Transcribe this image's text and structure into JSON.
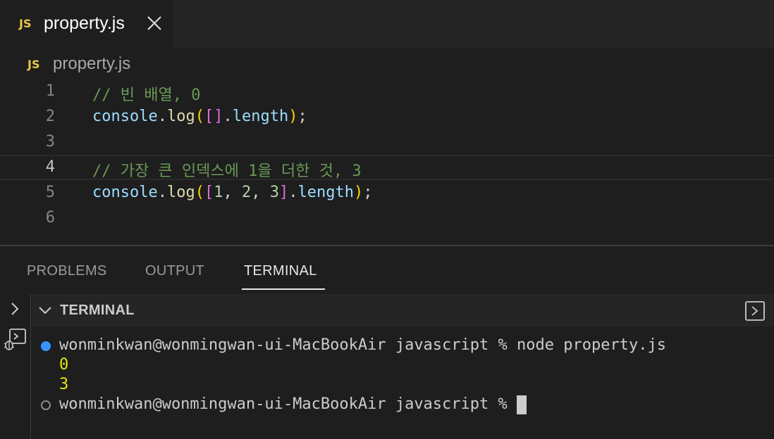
{
  "tab": {
    "lang_badge": "JS",
    "filename": "property.js"
  },
  "breadcrumb": {
    "lang_badge": "JS",
    "filename": "property.js"
  },
  "editor": {
    "lines": [
      {
        "number": "1"
      },
      {
        "number": "2"
      },
      {
        "number": "3"
      },
      {
        "number": "4"
      },
      {
        "number": "5"
      },
      {
        "number": "6"
      }
    ],
    "current_line": 4,
    "tokens": {
      "l1_comment": "// 빈 배열, 0",
      "l2_console": "console",
      "l2_dot": ".",
      "l2_log": "log",
      "l2_paren_open": "(",
      "l2_brackets": "[]",
      "l2_dot2": ".",
      "l2_length": "length",
      "l2_paren_close": ")",
      "l2_semi": ";",
      "l4_comment": "// 가장 큰 인덱스에 1을 더한 것, 3",
      "l5_console": "console",
      "l5_dot": ".",
      "l5_log": "log",
      "l5_paren_open": "(",
      "l5_bracket_open": "[",
      "l5_n1": "1",
      "l5_comma1": ", ",
      "l5_n2": "2",
      "l5_comma2": ", ",
      "l5_n3": "3",
      "l5_bracket_close": "]",
      "l5_dot2": ".",
      "l5_length": "length",
      "l5_paren_close": ")",
      "l5_semi": ";"
    }
  },
  "panel": {
    "tabs": [
      "PROBLEMS",
      "OUTPUT",
      "TERMINAL"
    ],
    "active_tab": "TERMINAL",
    "terminal_header": "TERMINAL"
  },
  "terminal": {
    "prompt": "wonminkwan@wonmingwan-ui-MacBookAir javascript % ",
    "command": "node property.js",
    "outputs": [
      "0",
      "3"
    ],
    "prompt2": "wonminkwan@wonmingwan-ui-MacBookAir javascript % "
  },
  "colors": {
    "js_badge": "#e8c84a",
    "comment": "#6a9955",
    "variable": "#9cdcfe",
    "function": "#dcdcaa",
    "bracket_gold": "#ffd700",
    "bracket_purple": "#da70d6",
    "number": "#b5cea8",
    "terminal_output": "#e5e510",
    "success_dot": "#3794ff"
  },
  "icons": [
    "close-icon",
    "chevron-right-icon",
    "terminal-debug-icon",
    "chevron-down-icon",
    "terminal-icon"
  ]
}
